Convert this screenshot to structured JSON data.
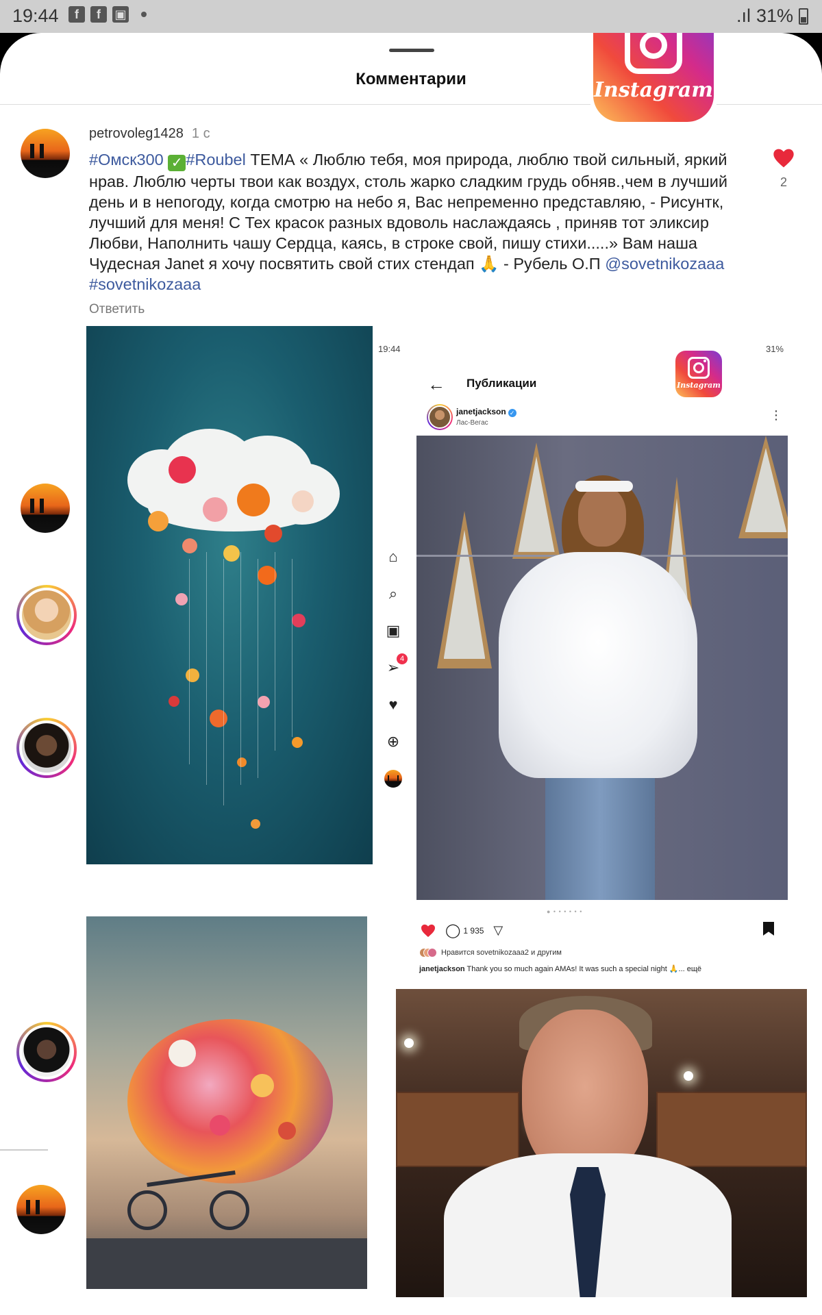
{
  "status_bar": {
    "time": "19:44",
    "icons": [
      "f-icon",
      "f-icon",
      "image-icon"
    ],
    "battery": "31%"
  },
  "sheet": {
    "title": "Комментарии"
  },
  "comment": {
    "username": "petrovoleg1428",
    "time": "1 с",
    "tag1": "#Омск300",
    "check": "✓",
    "tag2": "#Roubel",
    "text": " ТЕМА « Люблю тебя, моя природа, люблю твой сильный, яркий нрав. Люблю черты твои как воздух, столь жарко сладким грудь обняв.,чем в лучший день и в непогоду, когда смотрю на небо я, Вас непременно представляю, - Рисунтк, лучший для меня!  С Тех красок разных вдоволь наслаждаясь , приняв тот  эликсир Любви, Наполнить чашу Сердца, каясь, в строке свой, пишу стихи.....» Вам наша Чудесная  Janet я хочу посвятить свой стих стендап ",
    "emoji": "🙏",
    "text2": " - Рубель О.П ",
    "mention": "@sovetnikozaaa",
    "hashtag": " #sovetnikozaaa",
    "reply_label": "Ответить",
    "like_count": "2"
  },
  "instagram_logo": {
    "word": "Instagram"
  },
  "embedded_post": {
    "status_time": "19:44",
    "status_battery": "31%",
    "title": "Публикации",
    "username": "janetjackson",
    "location": "Лас-Вегас",
    "comment_count": "1 935",
    "nav_badge": "4",
    "likes_text": "Нравится sovetnikozaaa2 и другим",
    "caption_user": "janetjackson",
    "caption_text": " Thank you so much again AMAs! It was such a special night 🙏... ещё",
    "carousel_dots": "● • • • • • •"
  },
  "colors": {
    "like_red": "#e8293b",
    "link_blue": "#3d5a9e",
    "ig_gradient": [
      "#fdc05a",
      "#f04a3c",
      "#d42b8a",
      "#7b3bd2"
    ]
  }
}
